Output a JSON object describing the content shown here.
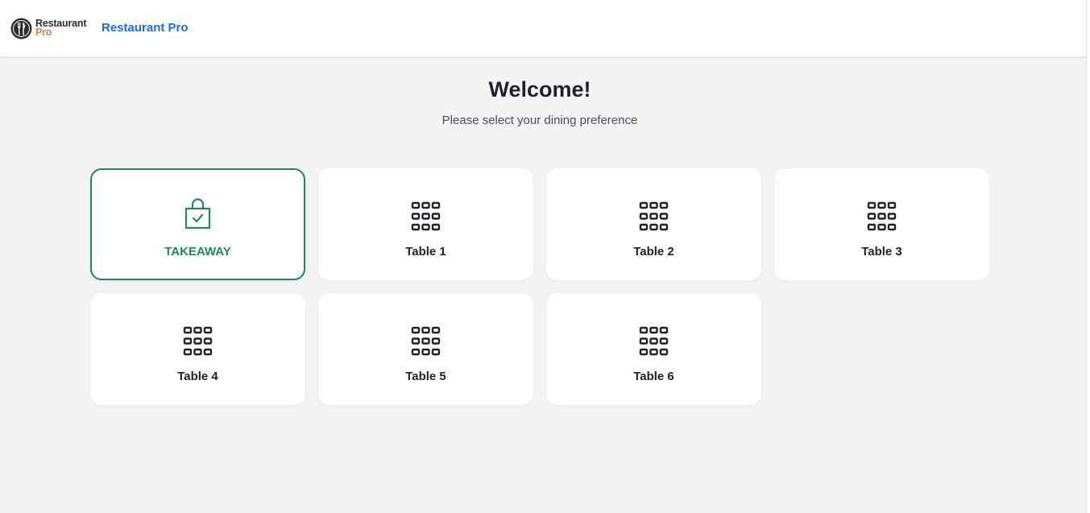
{
  "header": {
    "logo_line1": "Restaurant",
    "logo_line2": "Pro",
    "title": "Restaurant Pro"
  },
  "main": {
    "heading": "Welcome!",
    "subheading": "Please select your dining preference"
  },
  "options": [
    {
      "label": "TAKEAWAY",
      "icon": "shopping-bag-check-icon",
      "selected": true
    },
    {
      "label": "Table 1",
      "icon": "table-grid-icon",
      "selected": false
    },
    {
      "label": "Table 2",
      "icon": "table-grid-icon",
      "selected": false
    },
    {
      "label": "Table 3",
      "icon": "table-grid-icon",
      "selected": false
    },
    {
      "label": "Table 4",
      "icon": "table-grid-icon",
      "selected": false
    },
    {
      "label": "Table 5",
      "icon": "table-grid-icon",
      "selected": false
    },
    {
      "label": "Table 6",
      "icon": "table-grid-icon",
      "selected": false
    }
  ],
  "colors": {
    "accent": "#1f8a55",
    "brand_blue": "#1a6fe0",
    "logo_orange": "#e07a4f",
    "background": "#f3f4f6"
  }
}
